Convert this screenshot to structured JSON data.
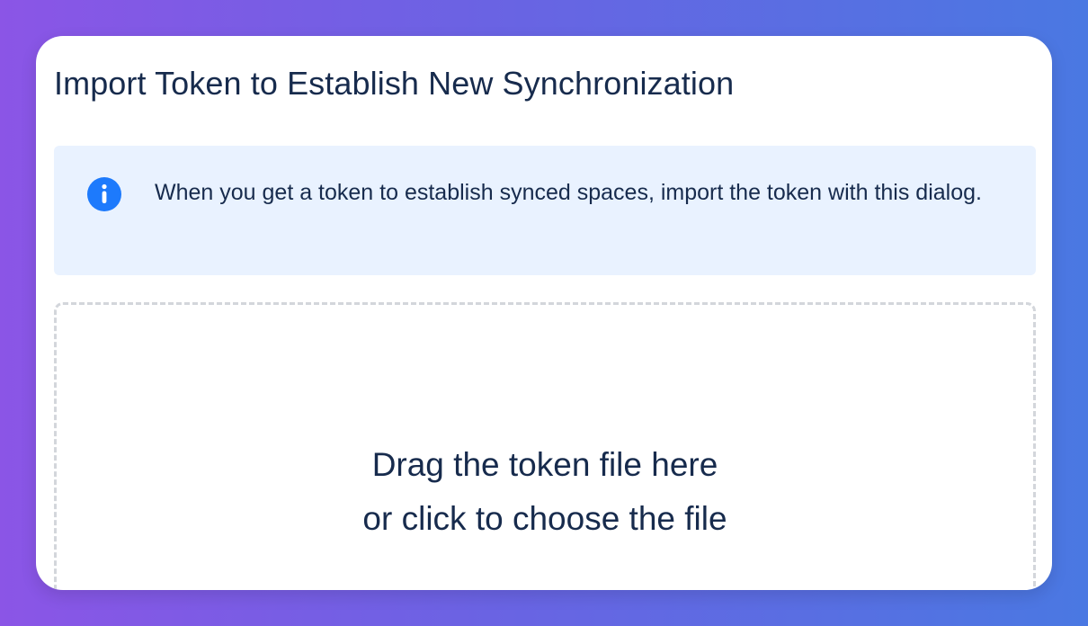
{
  "dialog": {
    "title": "Import Token to Establish New Synchronization"
  },
  "info": {
    "icon": "info-icon",
    "icon_color": "#1d7afc",
    "message": "When you get a token to establish synced spaces, import the token with this dialog."
  },
  "dropzone": {
    "line1": "Drag the token file here",
    "line2": "or click to choose the file"
  },
  "colors": {
    "text": "#172b4d",
    "info_background": "#e9f2ff",
    "dropzone_border": "#d3d6db"
  }
}
